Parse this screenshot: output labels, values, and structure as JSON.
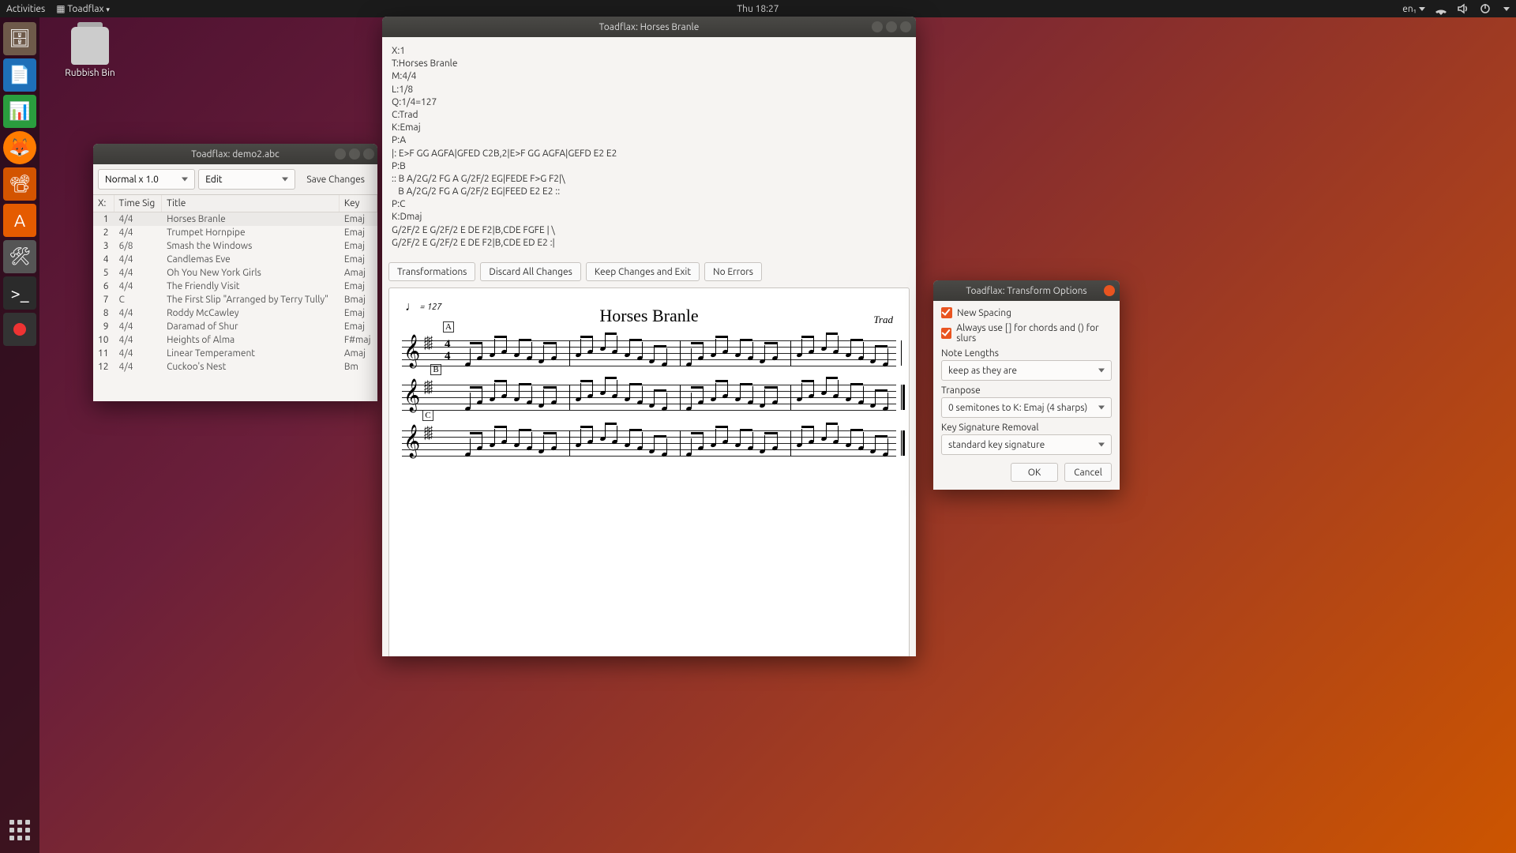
{
  "topbar": {
    "activities": "Activities",
    "appmenu": "Toadflax",
    "clock": "Thu 18:27",
    "lang": "en₁"
  },
  "desktop": {
    "trash": "Rubbish Bin"
  },
  "listWindow": {
    "title": "Toadflax: demo2.abc",
    "zoom": "Normal x 1.0",
    "mode": "Edit",
    "save": "Save Changes",
    "headers": {
      "x": "X:",
      "timesig": "Time Sig",
      "title": "Title",
      "key": "Key"
    },
    "rows": [
      {
        "x": "1",
        "ts": "4/4",
        "title": "Horses Branle",
        "key": "Emaj",
        "sel": true
      },
      {
        "x": "2",
        "ts": "4/4",
        "title": "Trumpet Hornpipe",
        "key": "Emaj"
      },
      {
        "x": "3",
        "ts": "6/8",
        "title": "Smash the Windows",
        "key": "Emaj"
      },
      {
        "x": "4",
        "ts": "4/4",
        "title": "Candlemas Eve",
        "key": "Emaj"
      },
      {
        "x": "5",
        "ts": "4/4",
        "title": "Oh You New York Girls",
        "key": "Amaj"
      },
      {
        "x": "6",
        "ts": "4/4",
        "title": "The Friendly Visit",
        "key": "Emaj"
      },
      {
        "x": "7",
        "ts": "C",
        "title": "The First Slip  \"Arranged by Terry Tully\"",
        "key": "Bmaj"
      },
      {
        "x": "8",
        "ts": "4/4",
        "title": "Roddy McCawley",
        "key": "Emaj"
      },
      {
        "x": "9",
        "ts": "4/4",
        "title": "Daramad of Shur",
        "key": "Emaj"
      },
      {
        "x": "10",
        "ts": "4/4",
        "title": "Heights of Alma",
        "key": "F#maj"
      },
      {
        "x": "11",
        "ts": "4/4",
        "title": "Linear Temperament",
        "key": "Amaj"
      },
      {
        "x": "12",
        "ts": "4/4",
        "title": "Cuckoo's Nest",
        "key": "Bm"
      }
    ]
  },
  "editorWindow": {
    "title": "Toadflax: Horses Branle",
    "abc": "X:1\nT:Horses Branle\nM:4/4\nL:1/8\nQ:1/4=127\nC:Trad\nK:Emaj\nP:A\n|: E>F GG AGFA|GFED C2B,2|E>F GG AGFA|GEFD E2 E2\nP:B\n:: B A/2G/2 FG A G/2F/2 EG|FEDE F>G F2|\\\n   B A/2G/2 FG A G/2F/2 EG|FEED E2 E2 ::\nP:C\nK:Dmaj\nG/2F/2 E G/2F/2 E DE F2|B,CDE FGFE | \\\nG/2F/2 E G/2F/2 E DE F2|B,CDE ED E2 :|",
    "buttons": {
      "transformations": "Transformations",
      "discard": "Discard All Changes",
      "keep": "Keep Changes and Exit",
      "errors": "No Errors"
    },
    "score": {
      "tempo": "= 127",
      "title": "Horses Branle",
      "composer": "Trad",
      "marks": [
        "A",
        "B",
        "C"
      ]
    }
  },
  "transformDialog": {
    "title": "Toadflax: Transform Options",
    "newSpacing": "New Spacing",
    "alwaysBrackets": "Always use [] for chords and () for slurs",
    "noteLengthsLabel": "Note Lengths",
    "noteLengthsValue": "keep as they are",
    "transposeLabel": "Tranpose",
    "transposeValue": "0 semitones to K: Emaj (4 sharps)",
    "keysigLabel": "Key Signature Removal",
    "keysigValue": "standard key signature",
    "ok": "OK",
    "cancel": "Cancel"
  }
}
